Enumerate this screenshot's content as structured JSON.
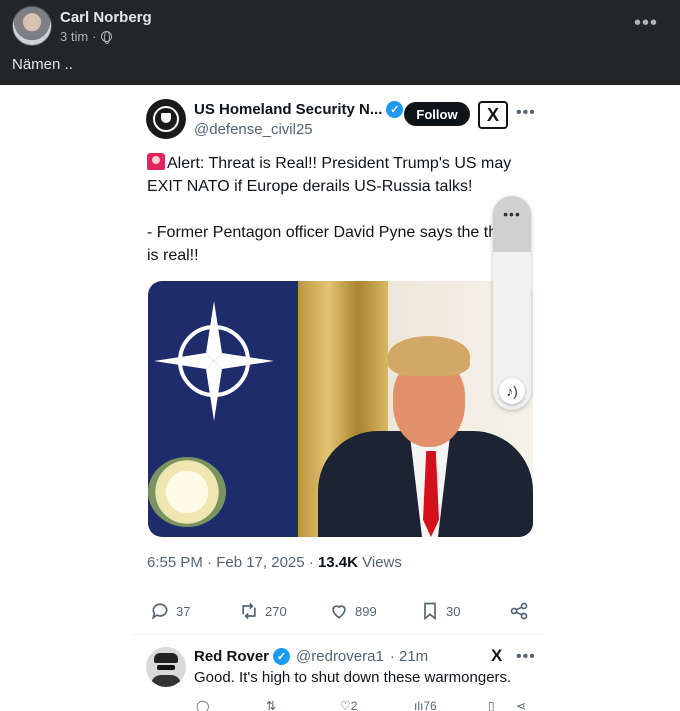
{
  "post": {
    "author": "Carl Norberg",
    "time": "3 tim",
    "dot": "·",
    "text": "Nämen .."
  },
  "tweet": {
    "name": "US Homeland Security N...",
    "handle": "@defense_civil25",
    "follow_label": "Follow",
    "x_logo": "X",
    "line1": "Alert: Threat is Real!! President Trump's US may EXIT NATO if Europe derails US-Russia talks!",
    "line2": "- Former Pentagon officer David Pyne says the threat is real!!",
    "timestamp": "6:55 PM · Feb 17, 2025 · ",
    "views_count": "13.4K",
    "views_label": " Views",
    "stats": {
      "replies": "37",
      "retweets": "270",
      "likes": "899",
      "bookmarks": "30"
    }
  },
  "overlay": {
    "more": "•••",
    "audio_icon": "audio-icon"
  },
  "reply": {
    "name": "Red Rover",
    "handle": "@redrovera1",
    "time": "· 21m",
    "text": "Good. It's high to shut down these warmongers.",
    "likes": "2",
    "views": "76"
  },
  "colors": {
    "fb_bg": "#242526",
    "verified": "#1d9bf0",
    "text": "#0f1419",
    "muted": "#536471"
  }
}
